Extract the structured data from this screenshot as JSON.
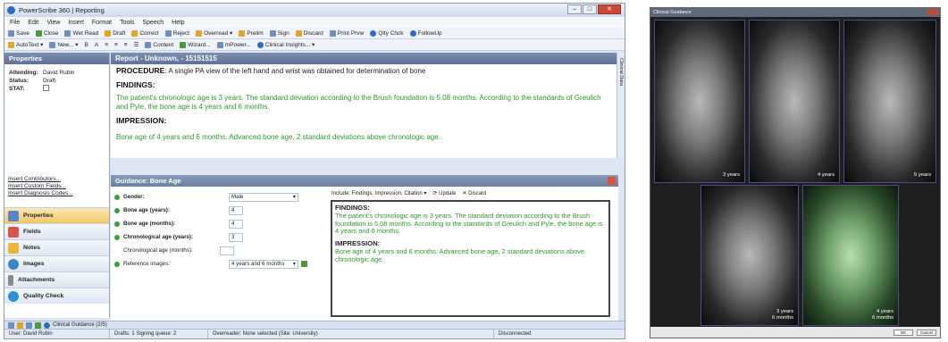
{
  "window": {
    "title": "PowerScribe 360 | Reporting"
  },
  "menu": [
    "File",
    "Edit",
    "View",
    "Insert",
    "Format",
    "Tools",
    "Speech",
    "Help"
  ],
  "toolbar1": [
    "Save",
    "Close",
    "Wet Read",
    "Draft",
    "Correct",
    "Reject",
    "Overread ▾",
    "Prelim",
    "Sign",
    "Discard",
    "Print Prvw",
    "Qlty Chck",
    "FollowUp"
  ],
  "toolbar2": [
    "AutoText ▾",
    "New... ▾",
    "Content",
    "Wizard...",
    "mPower...",
    "Clinical Insights... ▾"
  ],
  "properties": {
    "header": "Properties",
    "attending_label": "Attending:",
    "attending_value": "David Rubin",
    "status_label": "Status:",
    "status_value": "Draft",
    "stat_label": "STAT:"
  },
  "links": [
    "Insert Contributors...",
    "Insert Custom Fields...",
    "Insert Diagnosis Codes..."
  ],
  "nav": [
    "Properties",
    "Fields",
    "Notes",
    "Images",
    "Attachments",
    "Quality Check"
  ],
  "report": {
    "header": "Report - Unknown, - 15151515",
    "procedure_label": "PROCEDURE",
    "procedure_text": ": A single PA view of the left hand and wrist was obtained for determination of bone",
    "findings_label": "FINDINGS:",
    "findings_text": "The patient's chronologic age is 3 years. The standard deviation according to the Brush foundation is 5.08 months. According to the standards of Greulich and Pyle, the bone age is 4 years and 6 months.",
    "impression_label": "IMPRESSION:",
    "impression_text": "Bone age of 4 years and 6 months. Advanced bone age, 2 standard deviations above chronologic age.",
    "sidetab": "Clinical Data"
  },
  "guidance": {
    "header": "Guidance: Bone Age",
    "fields": [
      {
        "label": "Gender:",
        "value": "Male",
        "kind": "select"
      },
      {
        "label": "Bone age (years):",
        "value": "4",
        "kind": "num"
      },
      {
        "label": "Bone age (months):",
        "value": "4",
        "kind": "num"
      },
      {
        "label": "Chronological age (years):",
        "value": "3",
        "kind": "num"
      },
      {
        "label": "Chronological age (months):",
        "value": "",
        "kind": "num"
      },
      {
        "label": "Reference images:",
        "value": "4 years and 6 months",
        "kind": "select"
      }
    ],
    "include_label": "Include: Findings, Impression, Citation",
    "update": "Update",
    "discard": "Discard",
    "findings_label": "FINDINGS:",
    "findings_text": "The patient's chronologic age is 3 years. The standard deviation according to the Brush foundation is 5.08 months. According to the standards of Greulich and Pyle, the bone age is 4 years and 6 months.",
    "impression_label": "IMPRESSION:",
    "impression_text": "Bone age of 4 years and 6 months. Advanced bone age, 2 standard deviations above chronologic age."
  },
  "tray": {
    "label": "Clinical Guidance (2/5)"
  },
  "status": {
    "user": "User: David Rubin",
    "drafts": "Drafts: 1  Signing queue: 2",
    "overreader": "Overreader: None selected (Site: University)",
    "connection": "Disconnected"
  },
  "clinical_guidance": {
    "title": "Clinical Guidance",
    "images": [
      {
        "caption": "3 years"
      },
      {
        "caption": "4 years"
      },
      {
        "caption": "5 years"
      },
      {
        "caption": "3 years\n6 months"
      },
      {
        "caption": "4 years\n6 months"
      }
    ],
    "ok": "OK",
    "cancel": "Cancel"
  }
}
